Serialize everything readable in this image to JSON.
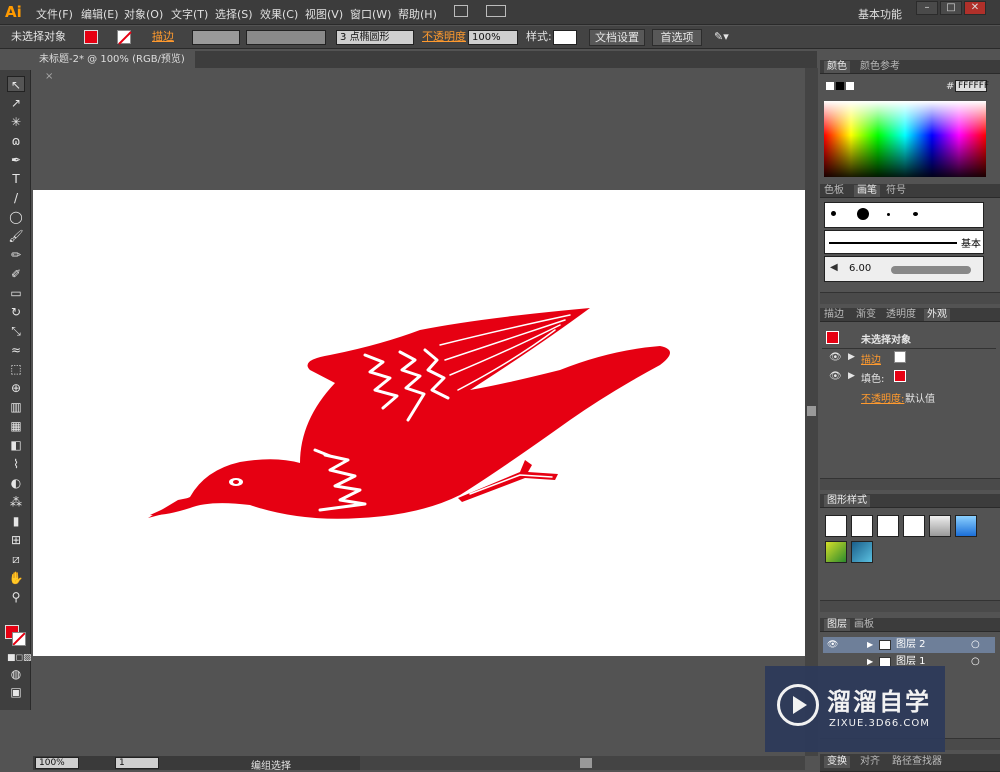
{
  "app": {
    "logo": "Ai"
  },
  "menu": [
    "文件(F)",
    "编辑(E)",
    "对象(O)",
    "文字(T)",
    "选择(S)",
    "效果(C)",
    "视图(V)",
    "窗口(W)",
    "帮助(H)"
  ],
  "workspace": "基本功能",
  "window_buttons": [
    "–",
    "□",
    "✕"
  ],
  "control": {
    "no_selection": "未选择对象",
    "stroke_label": "描边",
    "stroke_weight": "",
    "brush_size_label": "3",
    "brush_name": "点椭圆形",
    "opacity_label": "不透明度",
    "opacity_value": "100%",
    "style_label": "样式:",
    "doc_setup": "文档设置",
    "preferences": "首选项"
  },
  "document_tab": {
    "title": "未标题-2* @ 100% (RGB/预览)"
  },
  "status": {
    "zoom": "100%",
    "page": "1",
    "mode": "编组选择"
  },
  "panels": {
    "color": {
      "tabs": [
        "颜色",
        "颜色参考"
      ],
      "hex_label": "#",
      "hex_value": "FFFFFF"
    },
    "brush": {
      "tabs": [
        "色板",
        "画笔",
        "符号"
      ],
      "basic": "基本",
      "size": "6.00"
    },
    "appearance": {
      "tabs": [
        "描边",
        "渐变",
        "透明度",
        "外观"
      ],
      "header": "未选择对象",
      "stroke": "描边",
      "fill": "填色:",
      "opacity": "不透明度:",
      "opacity_value": "默认值"
    },
    "graphic_styles": {
      "tabs": [
        "图形样式"
      ]
    },
    "layers": {
      "tabs": [
        "图层",
        "画板"
      ],
      "items": [
        "图层 2",
        "图层 1"
      ]
    },
    "bottom_tabs": [
      "变换",
      "对齐",
      "路径查找器"
    ]
  },
  "watermark": {
    "brand": "溜溜自学",
    "url": "ZIXUE.3D66.COM"
  },
  "colors": {
    "accent": "#e60012",
    "ui_dark": "#3c3c3c",
    "ui_mid": "#535353"
  }
}
